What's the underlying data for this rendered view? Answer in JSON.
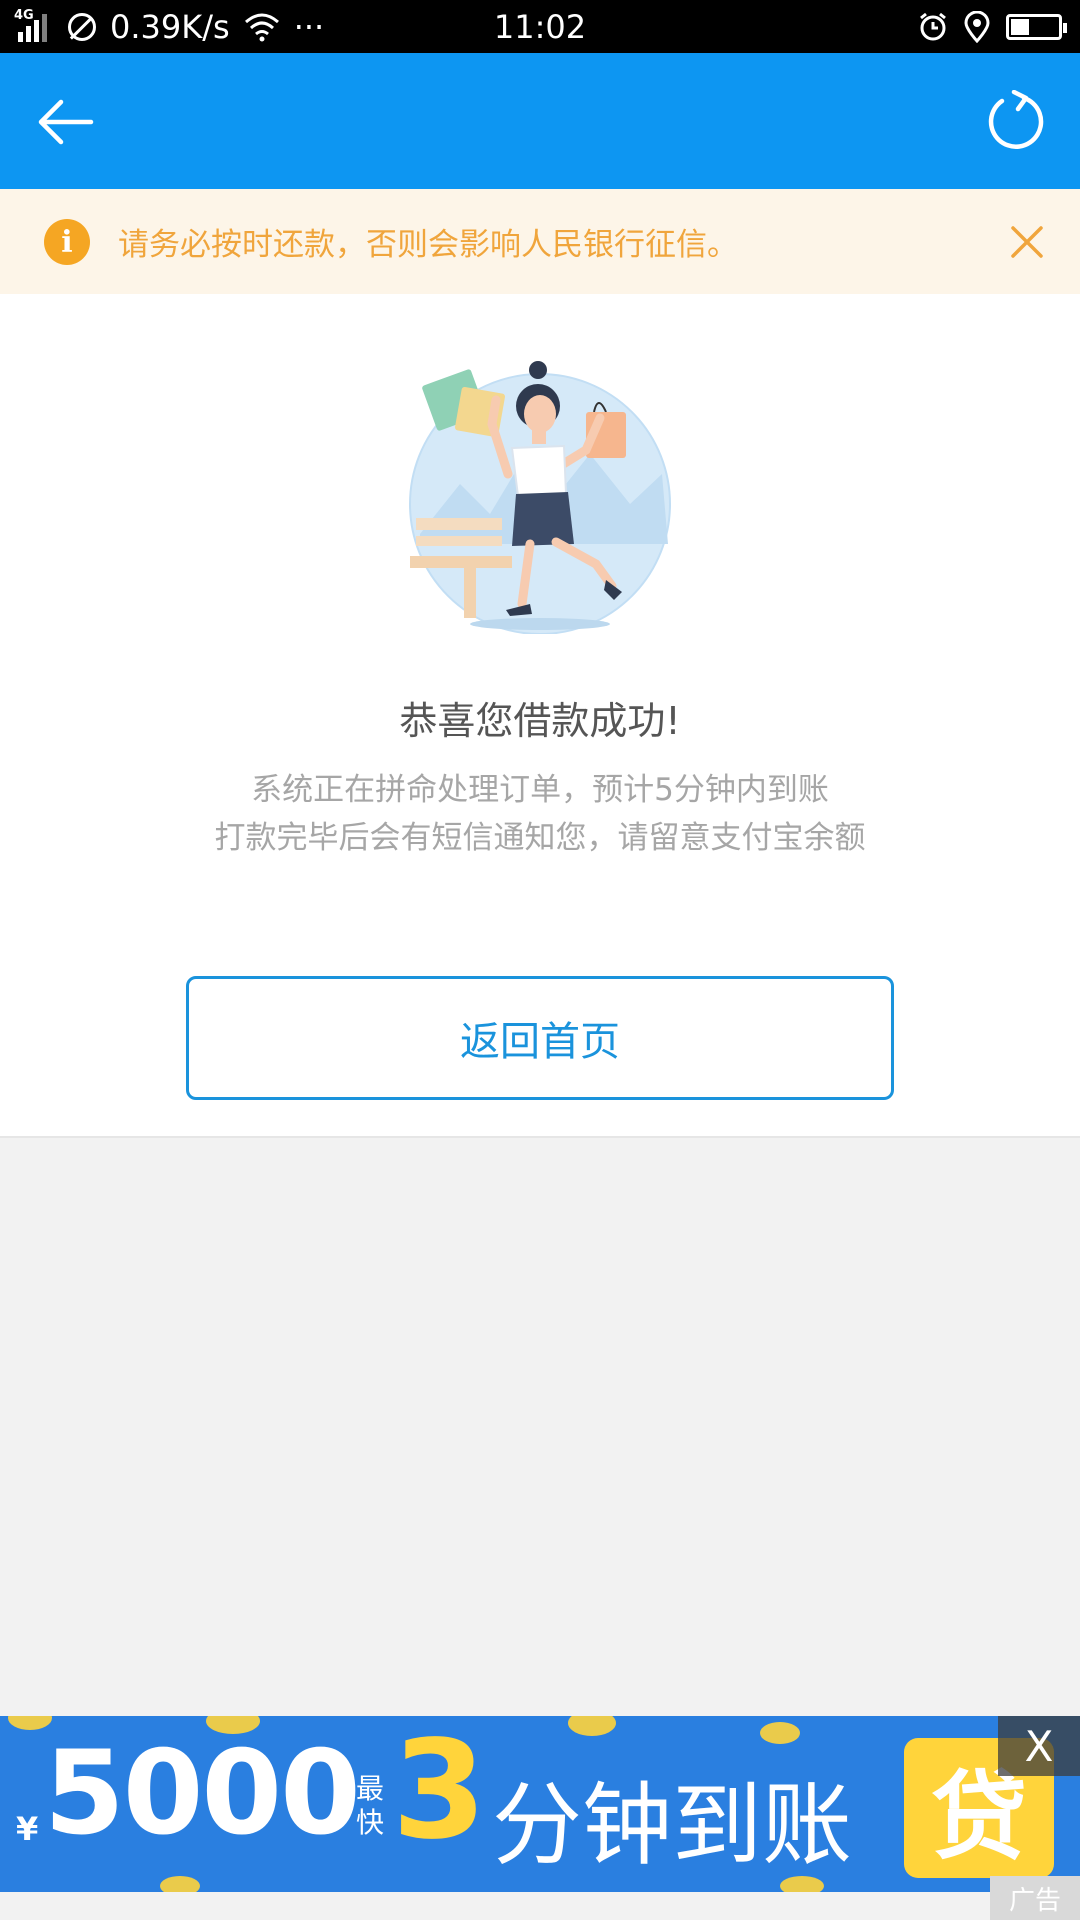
{
  "status_bar": {
    "network": "4G",
    "speed": "0.39K/s",
    "more": "···",
    "time": "11:02"
  },
  "app_bar": {
    "back_icon": "arrow-left-icon",
    "refresh_icon": "refresh-icon",
    "accent": "#0d96f2"
  },
  "notice": {
    "icon": "info-icon",
    "icon_glyph": "i",
    "text": "请务必按时还款，否则会影响人民银行征信。",
    "close_icon": "close-icon"
  },
  "result": {
    "illustration": "shopping-woman-illustration",
    "title": "恭喜您借款成功!",
    "desc_line1": "系统正在拼命处理订单，预计5分钟内到账",
    "desc_line2": "打款完毕后会有短信通知您，请留意支付宝余额",
    "home_button": "返回首页"
  },
  "ad": {
    "currency": "¥",
    "amount": "5000",
    "fastest": "最快",
    "number": "3",
    "slogan": "分钟到账",
    "badge": "贷",
    "close": "X",
    "tag": "广告"
  }
}
